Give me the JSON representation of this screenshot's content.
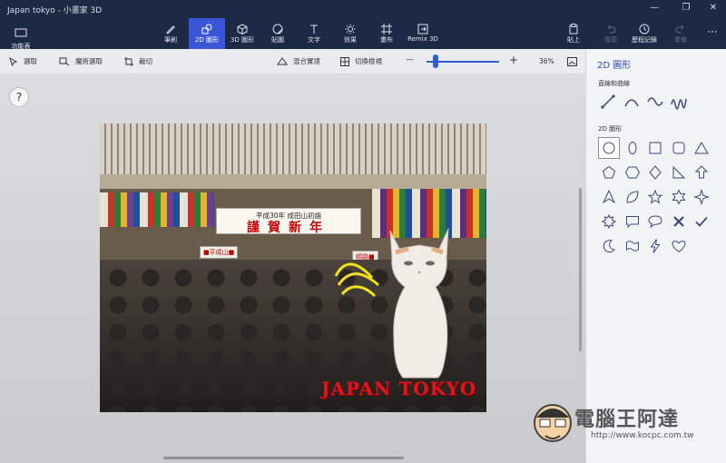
{
  "window": {
    "title": "Japan tokyo - 小畫家 3D",
    "controls": [
      "—",
      "❐",
      "✕"
    ]
  },
  "ribbon": {
    "menu_label": "功能表",
    "tools": [
      {
        "label": "筆刷",
        "icon": "brush-icon"
      },
      {
        "label": "2D 圖形",
        "icon": "shapes-2d-icon",
        "active": true
      },
      {
        "label": "3D 圖形",
        "icon": "cube-3d-icon"
      },
      {
        "label": "貼圖",
        "icon": "sticker-icon"
      },
      {
        "label": "文字",
        "icon": "text-icon"
      },
      {
        "label": "效果",
        "icon": "effects-icon"
      },
      {
        "label": "畫布",
        "icon": "canvas-icon"
      },
      {
        "label": "Remix 3D",
        "icon": "remix-3d-icon"
      }
    ],
    "right_tools": [
      {
        "label": "貼上",
        "icon": "paste-icon"
      },
      {
        "label": "復原",
        "icon": "undo-icon",
        "disabled": true
      },
      {
        "label": "歷程記錄",
        "icon": "history-icon"
      },
      {
        "label": "重做",
        "icon": "redo-icon",
        "disabled": true
      }
    ],
    "more_label": "···"
  },
  "toolbar2": {
    "select": "選取",
    "magic_select": "魔術選取",
    "crop": "裁切",
    "mixed_reality": "混合實境",
    "toggle_view": "切換檢視",
    "zoom_minus": "—",
    "zoom_plus": "+",
    "zoom_value": "36%",
    "zoom_fraction": 0.13
  },
  "canvas": {
    "help": "?",
    "banner_sub": "平成30年 成田山初詣",
    "banner_main": "謹賀新年",
    "sign_left": "■平成山■",
    "sign_right": "順路■",
    "caption": "JAPAN TOKYO"
  },
  "panel": {
    "title": "2D 圖形",
    "lines_section": "直線和曲線",
    "shapes_section": "2D 圖形",
    "line_tools": [
      "line-icon",
      "curve-icon",
      "wave-curve-icon",
      "multi-curve-icon"
    ],
    "shapes": [
      "circle-icon",
      "ellipse-icon",
      "square-icon",
      "rounded-square-icon",
      "triangle-icon",
      "pentagon-icon",
      "hexagon-icon",
      "diamond-icon",
      "right-triangle-icon",
      "arrow-up-icon",
      "arrow-triangle-icon",
      "leaf-icon",
      "star-5-icon",
      "star-6-icon",
      "star-4-icon",
      "starburst-icon",
      "speech-bubble-square-icon",
      "speech-bubble-round-icon",
      "cross-icon",
      "checkmark-icon",
      "moon-icon",
      "flag-icon",
      "lightning-icon",
      "heart-icon"
    ]
  },
  "watermark": {
    "name": "電腦王阿達",
    "url": "http://www.kocpc.com.tw"
  },
  "colors": {
    "ribbon": "#1d2a45",
    "accent": "#3b55d9",
    "panel": "#f2f3f5",
    "caption": "#e0161c"
  }
}
